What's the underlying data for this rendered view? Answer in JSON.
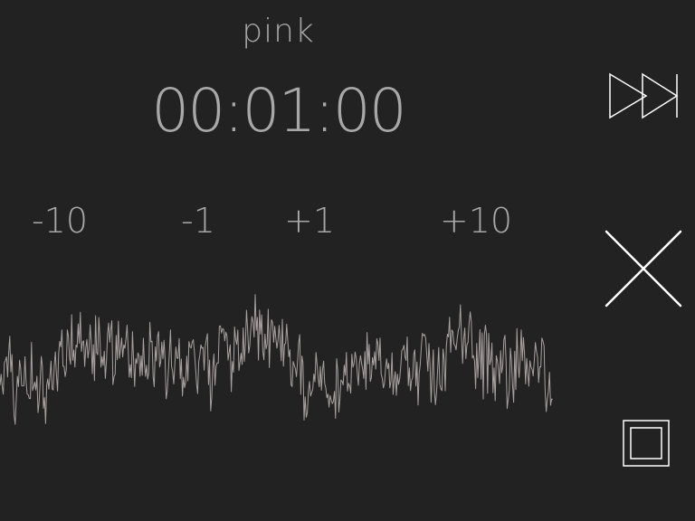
{
  "noise": {
    "name": "pink"
  },
  "timer": {
    "display": "00:01:00"
  },
  "adjust": {
    "minus10": "-10",
    "minus1": "-1",
    "plus1": "+1",
    "plus10": "+10"
  },
  "controls": {
    "skip_icon": "skip-forward-icon",
    "close_icon": "close-icon",
    "stop_icon": "stop-icon"
  },
  "colors": {
    "background": "#222222",
    "text": "#a8a8a8",
    "waveform": "#a9a0a0",
    "icons": "#ffffff"
  }
}
